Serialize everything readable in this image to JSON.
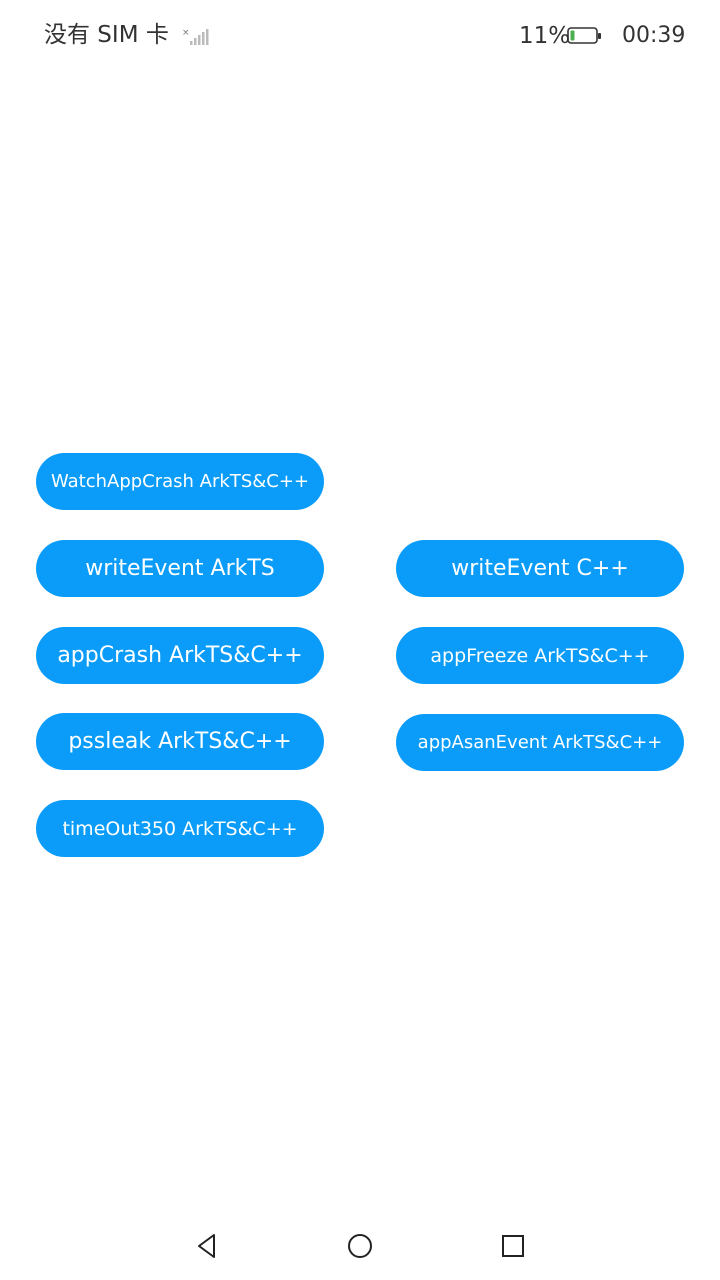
{
  "status_bar": {
    "carrier": "没有 SIM 卡",
    "battery_percent": "11%",
    "time": "00:39",
    "icons": [
      "signal-icon",
      "battery-icon"
    ]
  },
  "buttons": {
    "watch_app_crash": "WatchAppCrash ArkTS&C++",
    "write_event_arkts": "writeEvent ArkTS",
    "write_event_cpp": "writeEvent C++",
    "app_crash": "appCrash ArkTS&C++",
    "app_freeze": "appFreeze ArkTS&C++",
    "pss_leak": "pssleak ArkTS&C++",
    "app_asan_event": "appAsanEvent ArkTS&C++",
    "time_out_350": "timeOut350 ArkTS&C++"
  },
  "nav_bar": {
    "icons": [
      "back-icon",
      "home-icon",
      "recents-icon"
    ]
  },
  "colors": {
    "button_background": "#0a9cf8",
    "button_text": "#ffffff",
    "status_text": "#333333"
  }
}
